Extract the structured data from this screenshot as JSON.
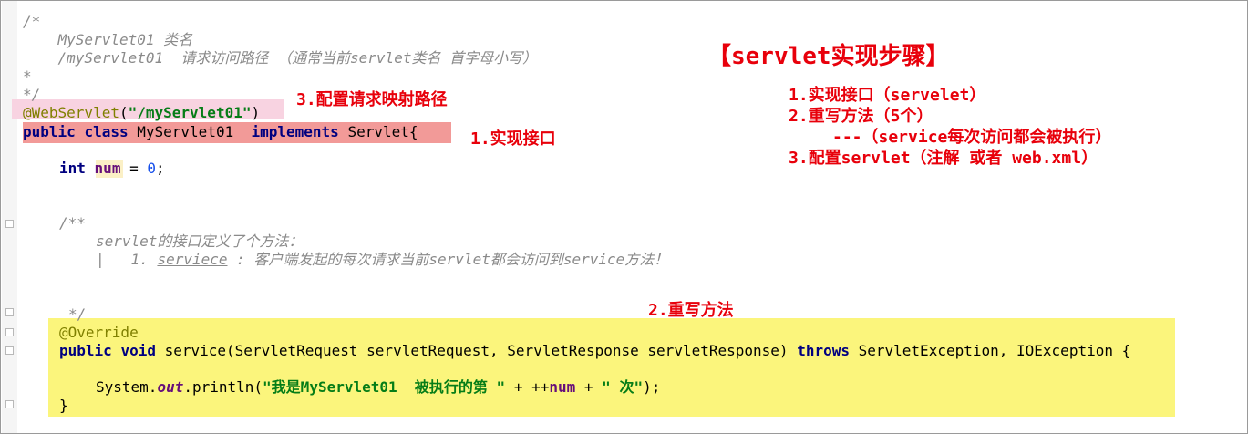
{
  "code": {
    "comment_open": "/*",
    "comment_class_name": "    MyServlet01 类名",
    "comment_path": "    /myServlet01  请求访问路径 （通常当前servlet类名 首字母小写）",
    "comment_star": "*",
    "comment_close": "*/",
    "annotation": "@WebServlet",
    "annotation_paren_open": "(",
    "annotation_value": "\"/myServlet01\"",
    "annotation_paren_close": ")",
    "kw_public": "public",
    "kw_class": "class",
    "class_name": "MyServlet01",
    "kw_implements": "implements",
    "interface_name": "Servlet{",
    "kw_int": "int",
    "var_num": "num",
    "num_assign": " = ",
    "num_value": "0",
    "semicolon": ";",
    "javadoc_open": "/**",
    "javadoc_line1": "servlet的接口定义了个方法：",
    "javadoc_item_prefix": "1. ",
    "javadoc_item_method": "serviece",
    "javadoc_item_rest": " : 客户端发起的每次请求当前servlet都会访问到service方法！",
    "javadoc_close": "*/",
    "override": "@Override",
    "kw_void": "void",
    "method_signature": "service(ServletRequest servletRequest, ServletResponse servletResponse)",
    "kw_throws": "throws",
    "exceptions": "ServletException, IOException {",
    "sys": "System.",
    "sys_out": "out",
    "println_open": ".println(",
    "println_str1": "\"我是MyServlet01  被执行的第 \"",
    "println_concat1": " + ++",
    "println_num": "num",
    "println_concat2": " + ",
    "println_str2": "\" 次\"",
    "println_close": ");",
    "brace_close": "}"
  },
  "notes": {
    "title": "【servlet实现步骤】",
    "step1": "1.实现接口（servelet）",
    "step2": "2.重写方法（5个）",
    "step2_detail": "---（service每次访问都会被执行）",
    "step3": "3.配置servlet（注解 或者 web.xml）",
    "label_mapping": "3.配置请求映射路径",
    "label_interface": "1.实现接口",
    "label_override": "2.重写方法"
  },
  "colors": {
    "annotation_highlight": "#f8d3e1",
    "class_highlight": "#f29a98",
    "method_highlight": "#fbf57c",
    "note_red": "#e8000b"
  }
}
